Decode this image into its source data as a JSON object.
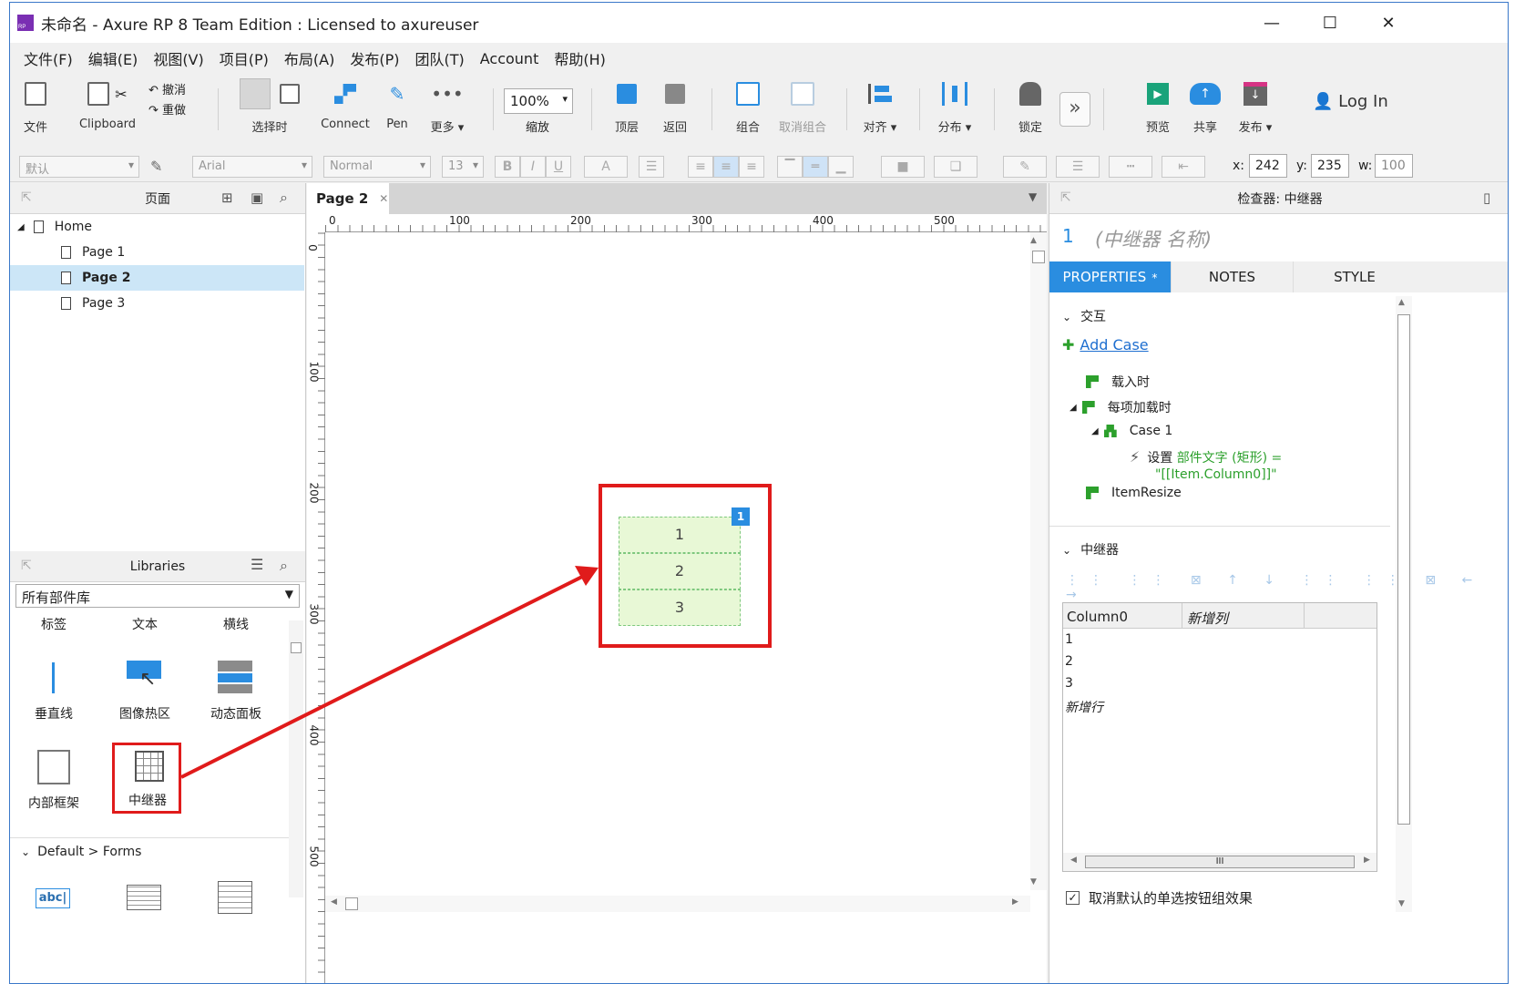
{
  "window": {
    "title": "未命名 - Axure RP 8 Team Edition : Licensed to axureuser",
    "logo": "RP",
    "minimize": "—",
    "maximize": "☐",
    "close": "✕"
  },
  "menu": [
    "文件(F)",
    "编辑(E)",
    "视图(V)",
    "项目(P)",
    "布局(A)",
    "发布(P)",
    "团队(T)",
    "Account",
    "帮助(H)"
  ],
  "toolbar": {
    "file": "文件",
    "clipboard": "Clipboard",
    "undo": "撤消",
    "redo": "重做",
    "select": "选择时",
    "connect": "Connect",
    "pen": "Pen",
    "more": "更多 ▾",
    "zoom_value": "100%",
    "zoom": "缩放",
    "top": "顶层",
    "back": "返回",
    "group": "组合",
    "ungroup": "取消组合",
    "align": "对齐 ▾",
    "distribute": "分布 ▾",
    "lock": "锁定",
    "expand": "»",
    "preview": "预览",
    "share": "共享",
    "publish": "发布 ▾",
    "login": "Log In"
  },
  "format": {
    "style": "默认",
    "font": "Arial",
    "weight": "Normal",
    "size": "13",
    "bold": "B",
    "italic": "I",
    "underline": "U",
    "color_a": "A",
    "x_label": "x:",
    "x": "242",
    "y_label": "y:",
    "y": "235",
    "w_label": "w:",
    "w": "100"
  },
  "pages": {
    "title": "页面",
    "items": [
      {
        "label": "Home"
      },
      {
        "label": "Page 1"
      },
      {
        "label": "Page 2"
      },
      {
        "label": "Page 3"
      }
    ]
  },
  "libraries": {
    "title": "Libraries",
    "dropdown": "所有部件库",
    "top_labels": [
      "标签",
      "文本",
      "横线"
    ],
    "widgets": [
      {
        "label": "垂直线"
      },
      {
        "label": "图像热区"
      },
      {
        "label": "动态面板"
      },
      {
        "label": "内部框架"
      },
      {
        "label": "中继器"
      }
    ],
    "forms_header": "Default > Forms",
    "form_icon": "abc|"
  },
  "canvas": {
    "tab": "Page 2",
    "tab_close": "✕",
    "ruler_h": [
      "0",
      "100",
      "200",
      "300",
      "400",
      "500"
    ],
    "ruler_v": [
      "0",
      "100",
      "200",
      "300",
      "400",
      "500"
    ],
    "repeater_rows": [
      "1",
      "2",
      "3"
    ],
    "badge": "1"
  },
  "inspector": {
    "title": "检查器: 中继器",
    "number": "1",
    "name_placeholder": "(中继器 名称)",
    "tabs": [
      "PROPERTIES",
      "NOTES",
      "STYLE"
    ],
    "properties_asterisk": "*",
    "interaction_header": "交互",
    "add_case": "Add Case",
    "events": [
      "载入时",
      "每项加载时",
      "ItemResize"
    ],
    "case": "Case 1",
    "action_prefix": "设置",
    "action_target": "部件文字 (矩形) =",
    "action_value": "\"[[Item.Column0]]\"",
    "repeater_header": "中继器",
    "dataset": {
      "columns": [
        "Column0",
        "新增列"
      ],
      "rows": [
        "1",
        "2",
        "3"
      ],
      "new_row": "新增行"
    },
    "scroll_grip": "III",
    "checkbox_label": "取消默认的单选按钮组效果"
  }
}
